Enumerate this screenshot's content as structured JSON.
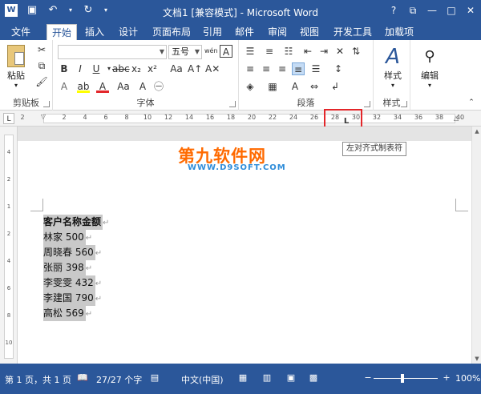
{
  "titlebar": {
    "title": "文档1 [兼容模式] - Microsoft Word",
    "qat_icons": [
      "word-logo-icon",
      "save-icon",
      "undo-icon",
      "redo-icon"
    ],
    "window_controls": [
      "help-icon",
      "restore-ribbon-icon",
      "minimize-icon",
      "maximize-icon",
      "close-icon"
    ]
  },
  "tabs": {
    "file": "文件",
    "items": [
      "开始",
      "插入",
      "设计",
      "页面布局",
      "引用",
      "邮件",
      "审阅",
      "视图",
      "开发工具",
      "加载项"
    ],
    "active": "开始"
  },
  "ribbon": {
    "clipboard": {
      "label": "剪贴板",
      "paste": "粘贴"
    },
    "font": {
      "label": "字体",
      "font_name": "",
      "font_size": "五号",
      "phonetic": "wén",
      "font_box": "A"
    },
    "paragraph": {
      "label": "段落"
    },
    "styles": {
      "label": "样式",
      "button": "样式"
    },
    "editing": {
      "button": "编辑"
    }
  },
  "ruler": {
    "ticks": [
      "2",
      "2",
      "4",
      "6",
      "8",
      "10",
      "12",
      "14",
      "16",
      "18",
      "20",
      "22",
      "24",
      "26",
      "28",
      "30",
      "32",
      "34",
      "36",
      "38",
      "40"
    ],
    "tab_selector": "L",
    "tooltip": "左对齐式制表符",
    "vertical_ticks": [
      "4",
      "2",
      "1",
      "2",
      "4",
      "6",
      "8",
      "10"
    ]
  },
  "watermark": {
    "main": "第九软件网",
    "sub": "WWW.D9SOFT.COM"
  },
  "document": {
    "heading": "客户名称金额",
    "rows": [
      {
        "name": "林家",
        "amount": "500"
      },
      {
        "name": "周晓春",
        "amount": "560"
      },
      {
        "name": "张丽",
        "amount": "398"
      },
      {
        "name": "李雯雯",
        "amount": "432"
      },
      {
        "name": "李建国",
        "amount": "790"
      },
      {
        "name": "高松",
        "amount": "569"
      }
    ],
    "paragraph_mark": "↵"
  },
  "statusbar": {
    "page": "第 1 页，共 1 页",
    "words": "27/27 个字",
    "language": "中文(中国)",
    "zoom": "100%",
    "zoom_minus": "−",
    "zoom_plus": "+"
  },
  "colors": {
    "brand": "#2b579a",
    "highlight_box": "#e3262a",
    "watermark_main": "#ff6a00",
    "watermark_sub": "#2e8cd9",
    "text_selection": "#c9c9c9"
  }
}
